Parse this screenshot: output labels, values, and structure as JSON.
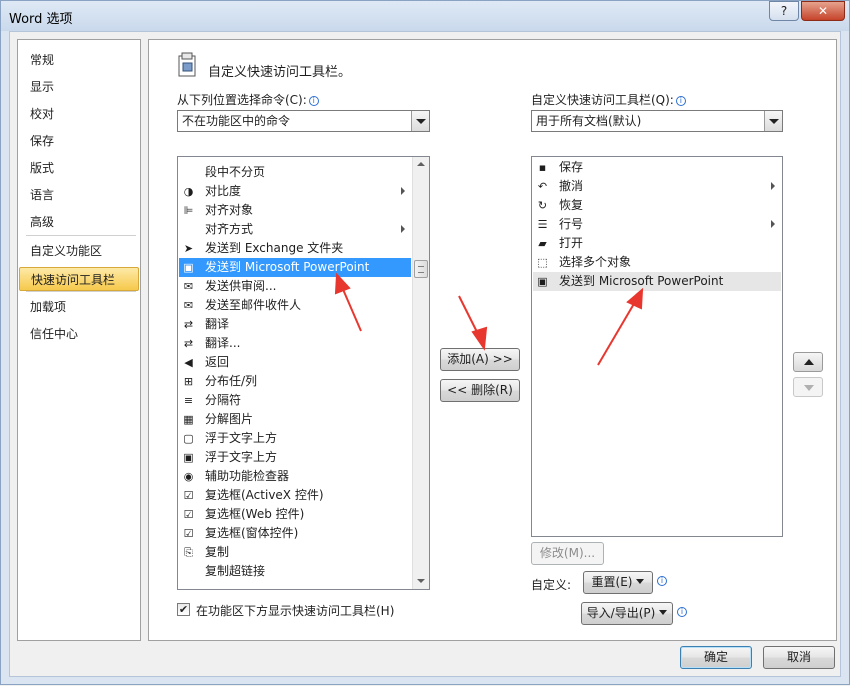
{
  "window": {
    "title": "Word 选项",
    "help_glyph": "?",
    "close_glyph": "✕"
  },
  "nav": {
    "items": [
      {
        "label": "常规",
        "active": false
      },
      {
        "label": "显示",
        "active": false
      },
      {
        "label": "校对",
        "active": false
      },
      {
        "label": "保存",
        "active": false
      },
      {
        "label": "版式",
        "active": false
      },
      {
        "label": "语言",
        "active": false
      },
      {
        "label": "高级",
        "active": false
      },
      {
        "label": "自定义功能区",
        "active": false
      },
      {
        "label": "快速访问工具栏",
        "active": true
      },
      {
        "label": "加载项",
        "active": false
      },
      {
        "label": "信任中心",
        "active": false
      }
    ]
  },
  "main": {
    "heading": "自定义快速访问工具栏。",
    "left_label": "从下列位置选择命令(C):",
    "left_combo": "不在功能区中的命令",
    "right_label": "自定义快速访问工具栏(Q):",
    "right_combo": "用于所有文档(默认)",
    "left_list": [
      {
        "label": "段中不分页",
        "icon": "",
        "submenu": false,
        "selected": false
      },
      {
        "label": "对比度",
        "icon": "◑",
        "submenu": true,
        "selected": false
      },
      {
        "label": "对齐对象",
        "icon": "⊫",
        "submenu": false,
        "selected": false
      },
      {
        "label": "对齐方式",
        "icon": "",
        "submenu": true,
        "selected": false
      },
      {
        "label": "发送到 Exchange 文件夹",
        "icon": "➤",
        "submenu": false,
        "selected": false
      },
      {
        "label": "发送到 Microsoft PowerPoint",
        "icon": "▣",
        "submenu": false,
        "selected": true
      },
      {
        "label": "发送供审阅...",
        "icon": "✉",
        "submenu": false,
        "selected": false
      },
      {
        "label": "发送至邮件收件人",
        "icon": "✉",
        "submenu": false,
        "selected": false
      },
      {
        "label": "翻译",
        "icon": "⇄",
        "submenu": false,
        "selected": false
      },
      {
        "label": "翻译...",
        "icon": "⇄",
        "submenu": false,
        "selected": false
      },
      {
        "label": "返回",
        "icon": "◀",
        "submenu": false,
        "selected": false
      },
      {
        "label": "分布任/列",
        "icon": "⊞",
        "submenu": false,
        "selected": false
      },
      {
        "label": "分隔符",
        "icon": "≡",
        "submenu": false,
        "selected": false
      },
      {
        "label": "分解图片",
        "icon": "▦",
        "submenu": false,
        "selected": false
      },
      {
        "label": "浮于文字上方",
        "icon": "▢",
        "submenu": false,
        "selected": false
      },
      {
        "label": "浮于文字上方",
        "icon": "▣",
        "submenu": false,
        "selected": false
      },
      {
        "label": "辅助功能检查器",
        "icon": "◉",
        "submenu": false,
        "selected": false
      },
      {
        "label": "复选框(ActiveX 控件)",
        "icon": "☑",
        "submenu": false,
        "selected": false
      },
      {
        "label": "复选框(Web 控件)",
        "icon": "☑",
        "submenu": false,
        "selected": false
      },
      {
        "label": "复选框(窗体控件)",
        "icon": "☑",
        "submenu": false,
        "selected": false
      },
      {
        "label": "复制",
        "icon": "⎘",
        "submenu": false,
        "selected": false
      },
      {
        "label": "复制超链接",
        "icon": "",
        "submenu": false,
        "selected": false
      }
    ],
    "right_list": [
      {
        "label": "保存",
        "icon": "▪",
        "submenu": false,
        "highlight": false
      },
      {
        "label": "撤消",
        "icon": "↶",
        "submenu": true,
        "highlight": false
      },
      {
        "label": "恢复",
        "icon": "↻",
        "submenu": false,
        "highlight": false
      },
      {
        "label": "行号",
        "icon": "☰",
        "submenu": true,
        "highlight": false
      },
      {
        "label": "打开",
        "icon": "▰",
        "submenu": false,
        "highlight": false
      },
      {
        "label": "选择多个对象",
        "icon": "⬚",
        "submenu": false,
        "highlight": false
      },
      {
        "label": "发送到 Microsoft PowerPoint",
        "icon": "▣",
        "submenu": false,
        "highlight": true
      }
    ],
    "add_button": "添加(A) >>",
    "remove_button": "<< 删除(R)",
    "modify_button": "修改(M)...",
    "customize_label": "自定义:",
    "reset_button": "重置(E)",
    "import_export_button": "导入/导出(P)",
    "show_below_checkbox": {
      "label": "在功能区下方显示快速访问工具栏(H)",
      "checked": true
    }
  },
  "footer": {
    "ok": "确定",
    "cancel": "取消"
  },
  "colors": {
    "selection": "#3399ff",
    "nav_active": "#f6c94c",
    "annotation_arrow": "#e8372e"
  }
}
